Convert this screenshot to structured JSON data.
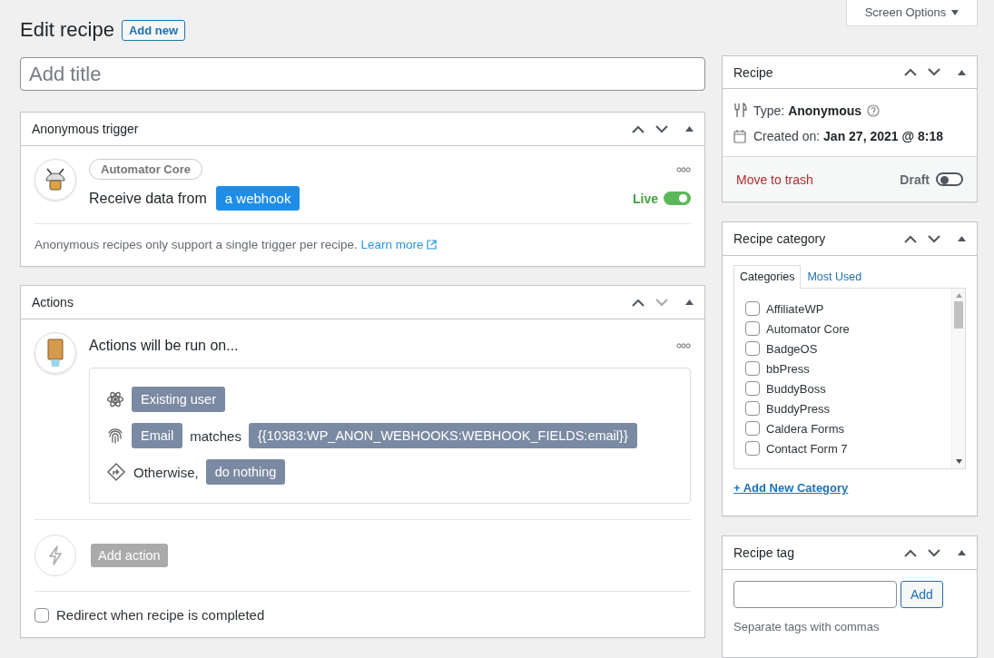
{
  "screen_options": {
    "label": "Screen Options"
  },
  "page_title": "Edit recipe",
  "add_new": "Add new",
  "title_field": {
    "placeholder": "Add title"
  },
  "trigger_panel": {
    "title": "Anonymous trigger",
    "move_down_disabled": false,
    "integration": "Automator Core",
    "sentence": "Receive data from",
    "token": "a webhook",
    "live_label": "Live",
    "live_on": true,
    "note": "Anonymous recipes only support a single trigger per recipe.",
    "link": "Learn more"
  },
  "actions_panel": {
    "title": "Actions",
    "move_down_disabled": true,
    "heading": "Actions will be run on...",
    "conditions": [
      {
        "kind": "user",
        "parts": [
          {
            "kind": "tag",
            "text": "Existing user"
          }
        ]
      },
      {
        "kind": "match",
        "parts": [
          {
            "kind": "tag",
            "text": "Email"
          },
          {
            "kind": "text",
            "text": "matches"
          },
          {
            "kind": "tag",
            "text": "{{10383:WP_ANON_WEBHOOKS:WEBHOOK_FIELDS:email}}"
          }
        ]
      },
      {
        "kind": "fallback",
        "parts": [
          {
            "kind": "text",
            "text": "Otherwise,"
          },
          {
            "kind": "tag",
            "text": "do nothing"
          }
        ]
      }
    ],
    "add_action": "Add action",
    "redirect": {
      "label": "Redirect when recipe is completed",
      "checked": false
    }
  },
  "recipe_box": {
    "title": "Recipe",
    "move_down_disabled": false,
    "type_label": "Type:",
    "type_value": "Anonymous",
    "created_label": "Created on:",
    "created_value": "Jan 27, 2021 @ 8:18",
    "trash": "Move to trash",
    "status_label": "Draft",
    "status_on": false
  },
  "category_box": {
    "title": "Recipe category",
    "move_down_disabled": false,
    "tabs": [
      {
        "label": "Categories",
        "selected": true
      },
      {
        "label": "Most Used",
        "selected": false
      }
    ],
    "items": [
      {
        "label": "AffiliateWP",
        "checked": false
      },
      {
        "label": "Automator Core",
        "checked": false
      },
      {
        "label": "BadgeOS",
        "checked": false
      },
      {
        "label": "bbPress",
        "checked": false
      },
      {
        "label": "BuddyBoss",
        "checked": false
      },
      {
        "label": "BuddyPress",
        "checked": false
      },
      {
        "label": "Caldera Forms",
        "checked": false
      },
      {
        "label": "Contact Form 7",
        "checked": false
      }
    ],
    "add_link": "+ Add New Category"
  },
  "tag_box": {
    "title": "Recipe tag",
    "move_down_disabled": false,
    "button": "Add",
    "hint": "Separate tags with commas"
  }
}
